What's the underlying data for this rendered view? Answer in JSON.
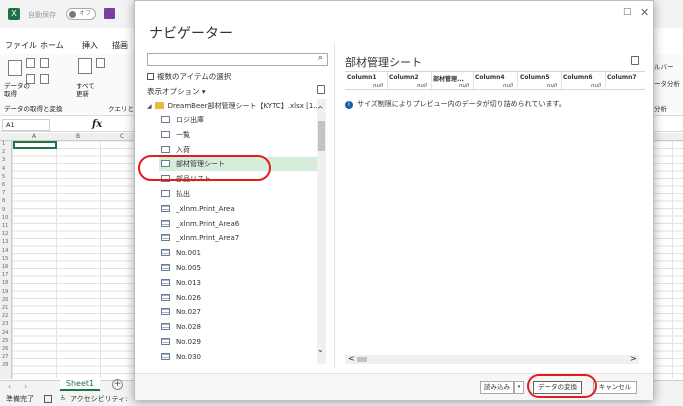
{
  "excel": {
    "autosave_label": "自動保存",
    "autosave_state": "オフ",
    "ribbon_tabs": [
      "ファイル",
      "ホーム",
      "挿入",
      "描画"
    ],
    "ribbon": {
      "get_data_label": "データの取得",
      "refresh_all_label": "すべて更新",
      "group_label": "データの取得と変換",
      "query_label": "クエリと",
      "right_label_1": "ルバー",
      "right_label_2": "ータ分析",
      "right_label_3": "分析"
    },
    "name_box": "A1",
    "fx": "fx",
    "columns": [
      "A",
      "B",
      "C"
    ],
    "rows": [
      "1",
      "2",
      "3",
      "4",
      "5",
      "6",
      "7",
      "8",
      "9",
      "10",
      "11",
      "12",
      "13",
      "14",
      "15",
      "16",
      "17",
      "18",
      "19",
      "20",
      "21",
      "22",
      "23",
      "24",
      "25",
      "26",
      "27",
      "28"
    ],
    "sheet_tab": "Sheet1",
    "add_sheet": "+",
    "status_ready": "準備完了",
    "status_accessibility": "アクセシビリティ:"
  },
  "navigator": {
    "title": "ナビゲーター",
    "search_placeholder": "",
    "multi_select_label": "複数のアイテムの選択",
    "display_options_label": "表示オプション ▾",
    "tree": {
      "root_label": "DreamBeer部材管理シート【KYTC】.xlsx [1...",
      "items": [
        {
          "label": "ロジ出庫",
          "type": "sheet"
        },
        {
          "label": "一覧",
          "type": "sheet"
        },
        {
          "label": "入荷",
          "type": "sheet"
        },
        {
          "label": "部材管理シート",
          "type": "sheet",
          "selected": true
        },
        {
          "label": "部品リスト",
          "type": "sheet"
        },
        {
          "label": "払出",
          "type": "sheet"
        },
        {
          "label": "_xlnm.Print_Area",
          "type": "table"
        },
        {
          "label": "_xlnm.Print_Area6",
          "type": "table"
        },
        {
          "label": "_xlnm.Print_Area7",
          "type": "table"
        },
        {
          "label": "No.001",
          "type": "table"
        },
        {
          "label": "No.005",
          "type": "table"
        },
        {
          "label": "No.013",
          "type": "table"
        },
        {
          "label": "No.026",
          "type": "table"
        },
        {
          "label": "No.027",
          "type": "table"
        },
        {
          "label": "No.028",
          "type": "table"
        },
        {
          "label": "No.029",
          "type": "table"
        },
        {
          "label": "No.030",
          "type": "table"
        }
      ]
    },
    "preview": {
      "title": "部材管理シート",
      "columns": [
        "Column1",
        "Column2",
        "部材管理...",
        "Column4",
        "Column5",
        "Column6",
        "Column7"
      ],
      "row_values": [
        "null",
        "null",
        "null",
        "null",
        "null",
        "null"
      ],
      "info_message": "サイズ制限によりプレビュー内のデータが切り詰められています。"
    },
    "buttons": {
      "load": "読み込み",
      "load_dropdown": "▾",
      "transform": "データの変換",
      "cancel": "キャンセル"
    },
    "window_controls": {
      "maximize": "□",
      "close": "✕"
    }
  }
}
